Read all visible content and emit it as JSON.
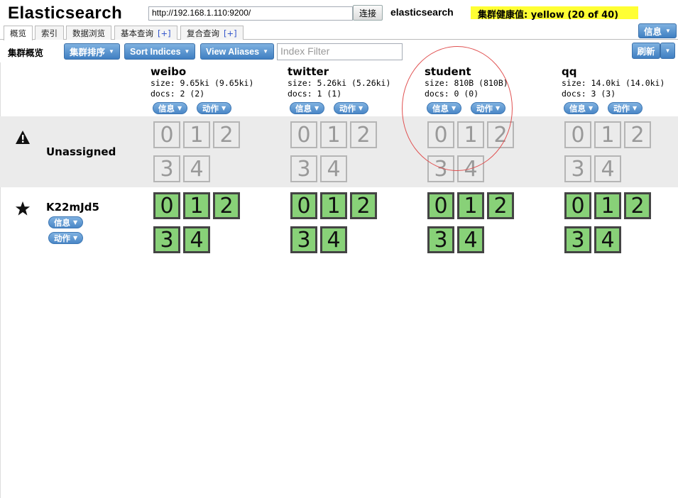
{
  "header": {
    "title": "Elasticsearch",
    "url": "http://192.168.1.110:9200/",
    "connect_label": "连接",
    "cluster_name": "elasticsearch",
    "health": "集群健康值: yellow (20 of 40)",
    "info_menu": "信息"
  },
  "tabs": [
    {
      "label": "概览",
      "plus": ""
    },
    {
      "label": "索引",
      "plus": ""
    },
    {
      "label": "数据浏览",
      "plus": ""
    },
    {
      "label": "基本查询",
      "plus": "[+]"
    },
    {
      "label": "复合查询",
      "plus": "[+]"
    }
  ],
  "toolbar": {
    "label": "集群概览",
    "sort_cluster": "集群排序",
    "sort_indices": "Sort Indices",
    "view_aliases": "View Aliases",
    "filter_placeholder": "Index Filter",
    "refresh": "刷新"
  },
  "indices": [
    {
      "name": "weibo",
      "size": "size: 9.65ki (9.65ki)",
      "docs": "docs: 2 (2)",
      "info": "信息",
      "action": "动作"
    },
    {
      "name": "twitter",
      "size": "size: 5.26ki (5.26ki)",
      "docs": "docs: 1 (1)",
      "info": "信息",
      "action": "动作"
    },
    {
      "name": "student",
      "size": "size: 810B (810B)",
      "docs": "docs: 0 (0)",
      "info": "信息",
      "action": "动作"
    },
    {
      "name": "qq",
      "size": "size: 14.0ki (14.0ki)",
      "docs": "docs: 3 (3)",
      "info": "信息",
      "action": "动作"
    }
  ],
  "rows": {
    "unassigned": {
      "label": "Unassigned",
      "icon": "warning-icon"
    },
    "node": {
      "label": "K22mJd5",
      "icon": "star-icon",
      "info": "信息",
      "action": "动作"
    }
  },
  "shards": [
    "0",
    "1",
    "2",
    "3",
    "4"
  ],
  "colors": {
    "health_yellow": "#ffff33",
    "shard_green": "#88d178",
    "button_blue": "#4a87c7",
    "annotation_red": "#e05050"
  }
}
